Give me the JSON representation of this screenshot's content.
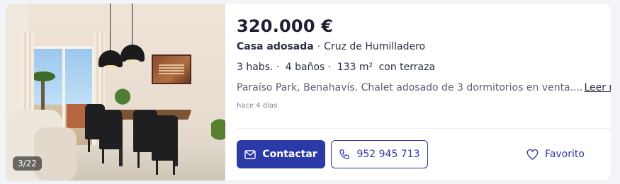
{
  "listing": {
    "photo_counter": "3/22",
    "price": "320.000 €",
    "type": "Casa adosada",
    "separator": "·",
    "location": "Cruz de Humilladero",
    "features": {
      "rooms": "3 habs. ·",
      "baths": "4 baños ·",
      "area": "133 m²",
      "extra": "con terraza"
    },
    "description": "Paraíso Park, Benahavís. Chalet adosado de 3 dormitorios en venta....",
    "read_more": "Leer más",
    "date": "hace 4 días"
  },
  "actions": {
    "contact_label": "Contactar",
    "phone_label": "952 945 713",
    "favorite_label": "Favorito"
  },
  "icons": {
    "contact": "envelope-icon",
    "phone": "phone-icon",
    "favorite": "heart-icon"
  },
  "colors": {
    "primary": "#2c3aa8",
    "background": "#f3f4f7",
    "card": "#ffffff"
  }
}
